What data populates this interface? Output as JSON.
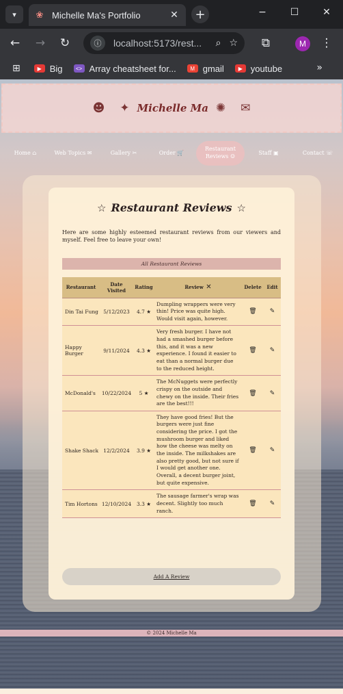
{
  "browser": {
    "tab_title": "Michelle Ma's Portfolio",
    "tab_close": "✕",
    "new_tab": "+",
    "url": "localhost:5173/rest...",
    "profile_initial": "M",
    "bookmarks": [
      {
        "label": "Big",
        "color": "#e53935",
        "icon": "youtube-icon"
      },
      {
        "label": "Array cheatsheet for...",
        "color": "#7e57c2",
        "icon": "code-icon"
      },
      {
        "label": "gmail",
        "color": "#ea4335",
        "icon": "gmail-icon"
      },
      {
        "label": "youtube",
        "color": "#e53935",
        "icon": "youtube-icon"
      }
    ]
  },
  "header": {
    "site_name": "Michelle Ma"
  },
  "nav": {
    "items": [
      {
        "label": "Home",
        "icon": "⌂"
      },
      {
        "label": "Web Topics",
        "icon": "✉"
      },
      {
        "label": "Gallery",
        "icon": "✂"
      },
      {
        "label": "Order",
        "icon": "🛒"
      },
      {
        "label": "Restaurant Reviews",
        "icon": "☺",
        "active": true
      },
      {
        "label": "Staff",
        "icon": "▣"
      },
      {
        "label": "Contact",
        "icon": "☏"
      }
    ]
  },
  "main": {
    "title": "Restaurant Reviews",
    "intro": "Here are some highly esteemed restaurant reviews from our viewers and myself. Feel free to leave your own!",
    "section_heading": "All Restaurant Reviews",
    "columns": [
      "Restaurant",
      "Date Visited",
      "Rating",
      "Review",
      "Delete",
      "Edit"
    ],
    "rows": [
      {
        "restaurant": "Din Tai Fung",
        "date": "5/12/2023",
        "rating": "4.7",
        "review": "Dumpling wrappers were very thin! Price was quite high. Would visit again, however."
      },
      {
        "restaurant": "Happy Burger",
        "date": "9/11/2024",
        "rating": "4.3",
        "review": "Very fresh burger. I have not had a smashed burger before this, and it was a new experience. I found it easier to eat than a normal burger due to the reduced height."
      },
      {
        "restaurant": "McDonald's",
        "date": "10/22/2024",
        "rating": "5",
        "review": "The McNuggets were perfectly crispy on the outside and chewy on the inside. Their fries are the best!!!"
      },
      {
        "restaurant": "Shake Shack",
        "date": "12/2/2024",
        "rating": "3.9",
        "review": "They have good fries! But the burgers were just fine considering the price. I got the mushroom burger and liked how the cheese was melty on the inside. The milkshakes are also pretty good, but not sure if I would get another one. Overall, a decent burger joint, but quite expensive."
      },
      {
        "restaurant": "Tim Hortons",
        "date": "12/10/2024",
        "rating": "3.3",
        "review": "The sausage farmer's wrap was decent. Slightly too much ranch."
      }
    ],
    "add_button": "Add A Review"
  },
  "footer": {
    "text": "© 2024 Michelle Ma"
  }
}
